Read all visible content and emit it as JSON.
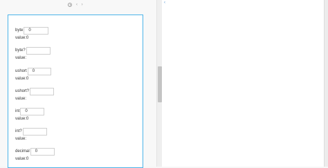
{
  "toolbar": {
    "history_icon": "clock-icon",
    "nav_text": "‹ ›"
  },
  "fields": [
    {
      "label": "byte",
      "input_value": "0",
      "value_text": "value:0"
    },
    {
      "label": "byte?",
      "input_value": "",
      "value_text": "value:"
    },
    {
      "label": "ushort",
      "input_value": "0",
      "value_text": "value:0"
    },
    {
      "label": "ushort?",
      "input_value": "",
      "value_text": "value:"
    },
    {
      "label": "int",
      "input_value": "0",
      "value_text": "value:0"
    },
    {
      "label": "int?",
      "input_value": "",
      "value_text": "value:"
    },
    {
      "label": "decimal",
      "input_value": "0",
      "value_text": "value:0"
    }
  ],
  "right_pane": {
    "collapse_glyph": "‹"
  },
  "colors": {
    "frame_border": "#4ab3e8",
    "accent": "#4a8fd0"
  }
}
